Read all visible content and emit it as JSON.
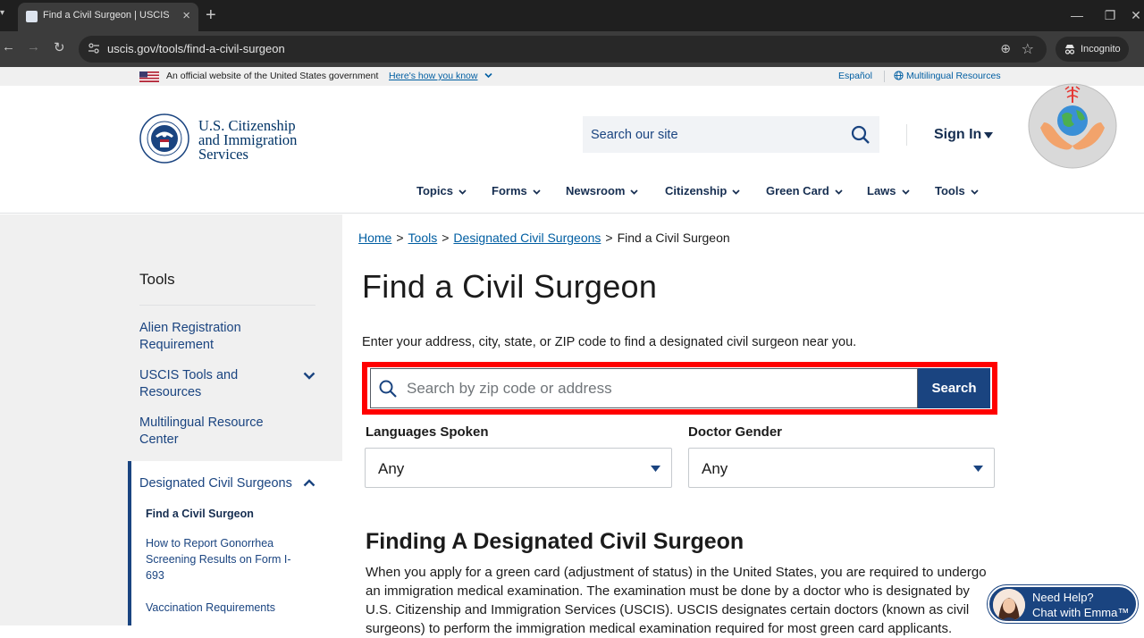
{
  "browser": {
    "tab_title": "Find a Civil Surgeon | USCIS",
    "url": "uscis.gov/tools/find-a-civil-surgeon",
    "incognito_label": "Incognito"
  },
  "gov_banner": {
    "text": "An official website of the United States government",
    "how_link": "Here's how you know",
    "espanol": "Español",
    "multilingual": "Multilingual Resources"
  },
  "header": {
    "logo_lines": [
      "U.S. Citizenship",
      "and Immigration",
      "Services"
    ],
    "search_placeholder": "Search our site",
    "sign_in": "Sign In"
  },
  "nav": {
    "items": [
      "Topics",
      "Forms",
      "Newsroom",
      "Citizenship",
      "Green Card",
      "Laws",
      "Tools"
    ]
  },
  "sidebar": {
    "title": "Tools",
    "items": [
      {
        "label": "Alien Registration Requirement"
      },
      {
        "label": "USCIS Tools and Resources"
      },
      {
        "label": "Multilingual Resource Center"
      },
      {
        "label": "Designated Civil Surgeons"
      }
    ],
    "sub_items": [
      {
        "label": "Find a Civil Surgeon"
      },
      {
        "label": "How to Report Gonorrhea Screening Results on Form I-693"
      },
      {
        "label": "Vaccination Requirements"
      }
    ]
  },
  "breadcrumb": {
    "items": [
      "Home",
      "Tools",
      "Designated Civil Surgeons"
    ],
    "current": "Find a Civil Surgeon",
    "separator": ">"
  },
  "main": {
    "title": "Find a Civil Surgeon",
    "intro": "Enter your address, city, state, or ZIP code to find a designated civil surgeon near you.",
    "search_placeholder": "Search by zip code or address",
    "search_button": "Search",
    "languages_label": "Languages Spoken",
    "languages_value": "Any",
    "gender_label": "Doctor Gender",
    "gender_value": "Any",
    "section_heading": "Finding A Designated Civil Surgeon",
    "section_body": "When you apply for a green card (adjustment of status) in the United States, you are required to undergo an immigration medical examination. The examination must be done by a doctor who is designated by U.S. Citizenship and Immigration Services (USCIS). USCIS designates certain doctors (known as civil surgeons) to perform the immigration medical examination required for most green card applicants."
  },
  "chat": {
    "line1": "Need Help?",
    "line2": "Chat with Emma™"
  },
  "colors": {
    "primary": "#1a4480",
    "dark_blue": "#162e51",
    "link": "#005ea2",
    "highlight": "#ff0000"
  }
}
